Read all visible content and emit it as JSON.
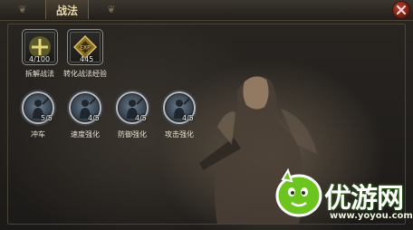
{
  "window": {
    "title": "战法",
    "close_icon": "close-icon"
  },
  "top_items": [
    {
      "icon": "plus-icon",
      "count": "4/100",
      "label": "拆解战法"
    },
    {
      "icon": "exp-token-icon",
      "count": "445",
      "label": "转化战法经验"
    }
  ],
  "skills": [
    {
      "icon": "warrior-portrait-icon",
      "level": "5/5",
      "label": "冲车"
    },
    {
      "icon": "warrior-portrait-icon",
      "level": "4/5",
      "label": "速度强化"
    },
    {
      "icon": "warrior-portrait-icon",
      "level": "4/5",
      "label": "防御强化"
    },
    {
      "icon": "warrior-portrait-icon",
      "level": "4/5",
      "label": "攻击强化"
    }
  ],
  "watermark": {
    "brand": "优游网",
    "url": "www.yoyou.com"
  },
  "colors": {
    "title_text": "#e7d7a8",
    "close_button": "#b8402e",
    "watermark_green": "#6cc51e"
  }
}
